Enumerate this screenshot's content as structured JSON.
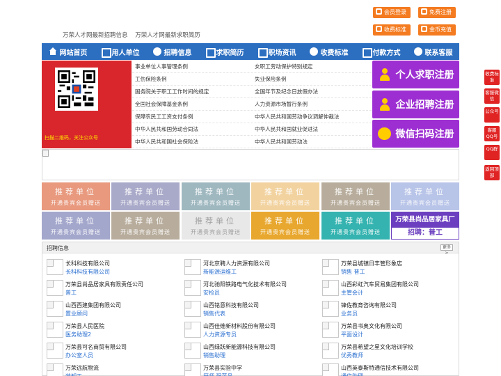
{
  "top_buttons": {
    "login": "会员登录",
    "register": "免费注册",
    "pricing": "收费标准",
    "recharge": "金币充值"
  },
  "slogans": [
    "万荣人才网最新招聘信息",
    "万荣人才网最新求职简历"
  ],
  "nav": [
    {
      "label": "网站首页",
      "icon": "home-icon"
    },
    {
      "label": "用人单位",
      "icon": "building-icon"
    },
    {
      "label": "招聘信息",
      "icon": "recruit-icon"
    },
    {
      "label": "求职简历",
      "icon": "resume-icon"
    },
    {
      "label": "职场资讯",
      "icon": "news-icon"
    },
    {
      "label": "收费标准",
      "icon": "pricing-icon"
    },
    {
      "label": "付款方式",
      "icon": "payment-icon"
    },
    {
      "label": "联系客服",
      "icon": "service-icon"
    }
  ],
  "qr": {
    "caption": "扫描二维码，关注公众号"
  },
  "policies": [
    [
      "事业单位人事管理条例",
      "女职工劳动保护特别规定"
    ],
    [
      "工伤保险条例",
      "失业保险条例"
    ],
    [
      "国务院关于职工工作时间的规定",
      "全国年节及纪念日放假办法"
    ],
    [
      "全国社会保障基金条例",
      "人力资源市场暂行条例"
    ],
    [
      "保障农民工工资支付条例",
      "中华人民共和国劳动争议调解仲裁法"
    ],
    [
      "中华人民共和国劳动合同法",
      "中华人民共和国就业促进法"
    ],
    [
      "中华人民共和国社会保险法",
      "中华人民共和国劳动法"
    ]
  ],
  "register": {
    "personal": "个人求职注册",
    "company": "企业招聘注册",
    "wechat": "微信扫码注册"
  },
  "recommend": {
    "title": "推荐单位",
    "subtitle": "开通贵宾会员赠送",
    "colors": [
      "#e8997e",
      "#a9a9c9",
      "#9fb8c0",
      "#f2d3a0",
      "#b8ad9c",
      "#b8c4e8",
      "#a4a7cc",
      "#b8ad9c",
      "#e8e8e8",
      "#e8a72e",
      "#34b3b0"
    ],
    "featured": {
      "name": "万荣县尚品居家具厂",
      "position": "招聘：普工"
    }
  },
  "recruit": {
    "title": "招聘信息",
    "more": "更多>",
    "jobs": [
      [
        {
          "company": "长科科技有限公司",
          "position": "长科科技有限公司"
        },
        {
          "company": "河北京聘人力资源有限公司",
          "position": "新能源运维工"
        },
        {
          "company": "万荣县城镇日丰管形象店",
          "position": "销售 普工"
        }
      ],
      [
        {
          "company": "万荣县尚品居家具有限责任公司",
          "position": "普工"
        },
        {
          "company": "河北驰阳铁路电气化技术有限公司",
          "position": "安检员"
        },
        {
          "company": "山西彩虹汽车贸易集团有限公司",
          "position": "主管会计"
        }
      ],
      [
        {
          "company": "山西西建集团有限公司",
          "position": "置业顾问"
        },
        {
          "company": "山西铭意科技有限公司",
          "position": "销售代表"
        },
        {
          "company": "锋佐教育咨询有限公司",
          "position": "业务员"
        }
      ],
      [
        {
          "company": "万荣县人民医院",
          "position": "医务助理2"
        },
        {
          "company": "山西佳维新材料股份有限公司",
          "position": "人力资源专员"
        },
        {
          "company": "万荣县书奥文化有限公司",
          "position": "平面设计"
        }
      ],
      [
        {
          "company": "万荣县可名商贸有限公司",
          "position": "办公室人员"
        },
        {
          "company": "山西绿跃新能源科技有限公司",
          "position": "销售助理"
        },
        {
          "company": "万荣县希望之星文化培训学校",
          "position": "优秀教师"
        }
      ],
      [
        {
          "company": "万荣远航物流",
          "position": "装卸工"
        },
        {
          "company": "万荣县实验中学",
          "position": "厨师 配菜员"
        },
        {
          "company": "山西英泰斯特通信技术有限公司",
          "position": "通信助理"
        }
      ]
    ]
  },
  "side_buttons": [
    "收费标准",
    "客服微信",
    "公众号",
    "客服QQ号",
    "QQ群",
    "返回顶部"
  ]
}
